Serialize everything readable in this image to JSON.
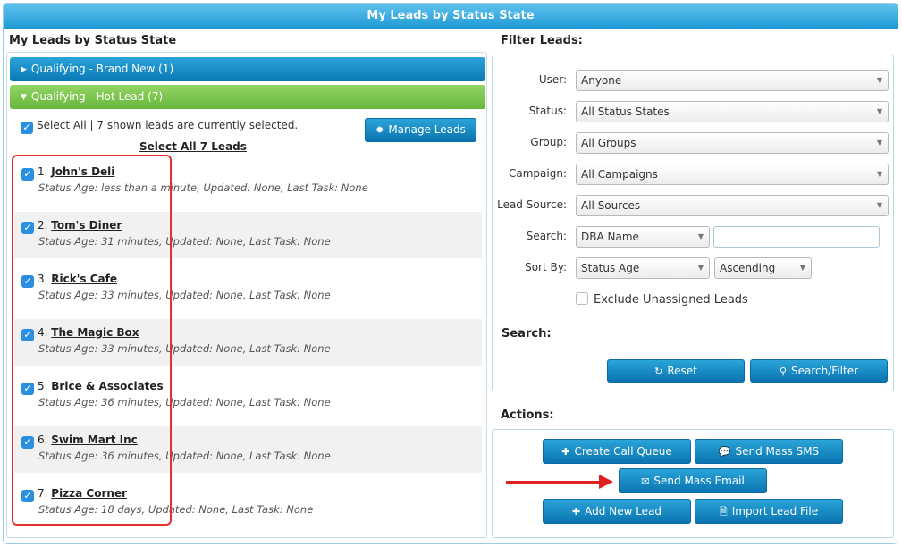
{
  "window": {
    "title": "My Leads by Status State"
  },
  "left": {
    "title": "My Leads by Status State",
    "group1": {
      "label": "Qualifying - Brand New (1)"
    },
    "group2": {
      "label": "Qualifying - Hot Lead (7)"
    },
    "select_all_text": "Select All | 7 shown leads are currently selected.",
    "select_all_link": "Select All 7 Leads",
    "manage_leads": "Manage Leads",
    "leads": [
      {
        "num": "1.",
        "name": "John's Deli",
        "detail": "Status Age: less than a minute, Updated: None, Last Task: None"
      },
      {
        "num": "2.",
        "name": "Tom's Diner",
        "detail": "Status Age: 31 minutes, Updated: None, Last Task: None"
      },
      {
        "num": "3.",
        "name": "Rick's Cafe",
        "detail": "Status Age: 33 minutes, Updated: None, Last Task: None"
      },
      {
        "num": "4.",
        "name": "The Magic Box",
        "detail": "Status Age: 33 minutes, Updated: None, Last Task: None"
      },
      {
        "num": "5.",
        "name": "Brice & Associates",
        "detail": "Status Age: 36 minutes, Updated: None, Last Task: None"
      },
      {
        "num": "6.",
        "name": "Swim Mart Inc",
        "detail": "Status Age: 36 minutes, Updated: None, Last Task: None"
      },
      {
        "num": "7.",
        "name": "Pizza Corner",
        "detail": "Status Age: 18 days, Updated: None, Last Task: None"
      }
    ]
  },
  "filter": {
    "title": "Filter Leads:",
    "user_label": "User:",
    "user_value": "Anyone",
    "status_label": "Status:",
    "status_value": "All Status States",
    "group_label": "Group:",
    "group_value": "All Groups",
    "campaign_label": "Campaign:",
    "campaign_value": "All Campaigns",
    "source_label": "Lead Source:",
    "source_value": "All Sources",
    "search_label": "Search:",
    "search_field_value": "DBA Name",
    "search_text": "",
    "sort_label": "Sort By:",
    "sort_value": "Status Age",
    "sort_order": "Ascending",
    "exclude_label": "Exclude Unassigned Leads",
    "search_section": "Search:",
    "reset": "Reset",
    "search_filter": "Search/Filter"
  },
  "actions": {
    "title": "Actions:",
    "create_call_queue": "Create Call Queue",
    "send_mass_sms": "Send Mass SMS",
    "send_mass_email": "Send Mass Email",
    "add_new_lead": "Add New Lead",
    "import_lead_file": "Import Lead File"
  }
}
